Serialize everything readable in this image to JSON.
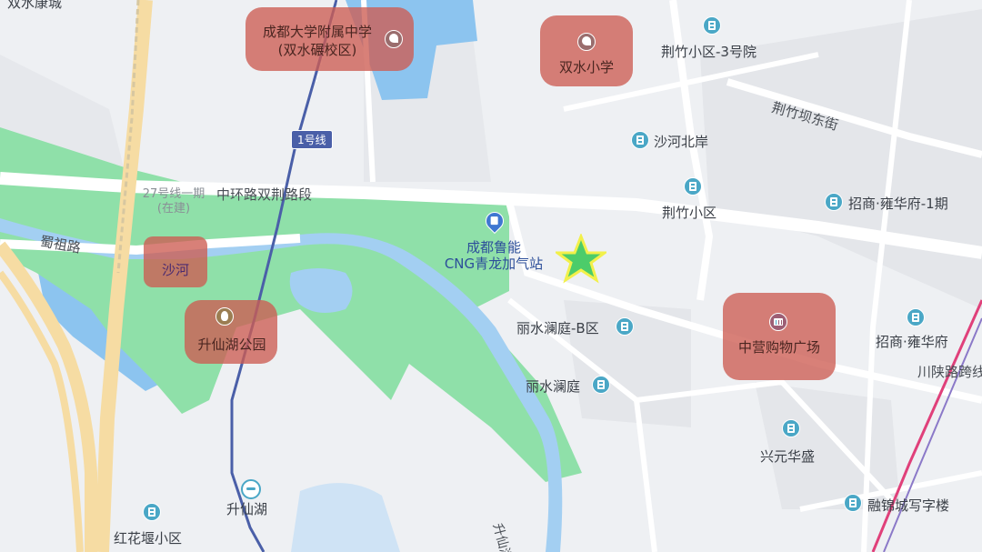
{
  "roads": {
    "zhonghuan": "中环路双荆路段",
    "shuzu": "蜀祖路",
    "jingzhuba_dong": "荆竹坝东街",
    "chuanshan": "川陕路跨线",
    "shengxianhu_bei": "升仙湖北",
    "line27": "27号线一期(在建)"
  },
  "metro": {
    "line1_badge": "1号线",
    "station": "升仙湖"
  },
  "places": {
    "shuangshui_kangcheng": "双水康城",
    "jingzhu_3": "荆竹小区-3号院",
    "shahe_beian": "沙河北岸",
    "jingzhu": "荆竹小区",
    "zhaoshang_1": "招商·雍华府-1期",
    "zhaoshang": "招商·雍华府",
    "gas_station_line1": "成都鲁能",
    "gas_station_line2": "CNG青龙加气站",
    "lishui_b": "丽水澜庭-B区",
    "lishui": "丽水澜庭",
    "xingyuan": "兴元华盛",
    "rongjin": "融锦城写字楼",
    "honghuayan": "红花堰小区"
  },
  "highlights": {
    "school1_line1": "成都大学附属中学",
    "school1_line2": "(双水碾校区)",
    "school2": "双水小学",
    "river": "沙河",
    "park": "升仙湖公园",
    "mall": "中营购物广场"
  },
  "colors": {
    "highlight": "#cd5c52",
    "park": "#8fe0a9",
    "water": "#8cc4ef",
    "metro_line1": "#4a5fa8",
    "railway": "#e0407a",
    "star": "#4ccc6a"
  },
  "icons": [
    "building-icon",
    "school-icon",
    "park-icon",
    "mall-icon",
    "gas-station-icon",
    "metro-icon",
    "star-marker-icon"
  ]
}
